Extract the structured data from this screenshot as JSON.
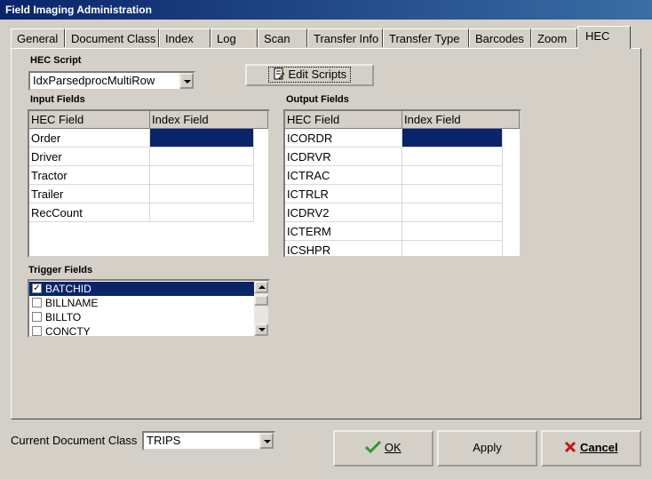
{
  "window": {
    "title": "Field Imaging Administration"
  },
  "tabs": [
    {
      "label": "General"
    },
    {
      "label": "Document Class"
    },
    {
      "label": "Index"
    },
    {
      "label": "Log"
    },
    {
      "label": "Scan"
    },
    {
      "label": "Transfer Info"
    },
    {
      "label": "Transfer Type"
    },
    {
      "label": "Barcodes"
    },
    {
      "label": "Zoom"
    },
    {
      "label": "HEC"
    }
  ],
  "hec_script": {
    "label": "HEC Script",
    "value": "IdxParsedprocMultiRow",
    "edit_button": "Edit Scripts"
  },
  "input_fields": {
    "label": "Input Fields",
    "columns": [
      "HEC Field",
      "Index Field"
    ],
    "rows": [
      {
        "hec": "Order",
        "index": ""
      },
      {
        "hec": "Driver",
        "index": ""
      },
      {
        "hec": "Tractor",
        "index": ""
      },
      {
        "hec": "Trailer",
        "index": ""
      },
      {
        "hec": "RecCount",
        "index": ""
      }
    ]
  },
  "output_fields": {
    "label": "Output Fields",
    "columns": [
      "HEC Field",
      "Index Field"
    ],
    "rows": [
      {
        "hec": "ICORDR",
        "index": ""
      },
      {
        "hec": "ICDRVR",
        "index": ""
      },
      {
        "hec": "ICTRAC",
        "index": ""
      },
      {
        "hec": "ICTRLR",
        "index": ""
      },
      {
        "hec": "ICDRV2",
        "index": ""
      },
      {
        "hec": "ICTERM",
        "index": ""
      },
      {
        "hec": "ICSHPR",
        "index": ""
      }
    ]
  },
  "trigger_fields": {
    "label": "Trigger Fields",
    "items": [
      {
        "label": "BATCHID",
        "checked": true
      },
      {
        "label": "BILLNAME",
        "checked": false
      },
      {
        "label": "BILLTO",
        "checked": false
      },
      {
        "label": "CONCTY",
        "checked": false
      }
    ]
  },
  "footer": {
    "doc_class_label": "Current Document Class",
    "doc_class_value": "TRIPS",
    "ok": "OK",
    "apply": "Apply",
    "cancel": "Cancel"
  },
  "colors": {
    "selection": "#0a246a",
    "face": "#d4d0c8",
    "ok_check": "#2e9a2e",
    "cancel_x": "#c01818"
  }
}
